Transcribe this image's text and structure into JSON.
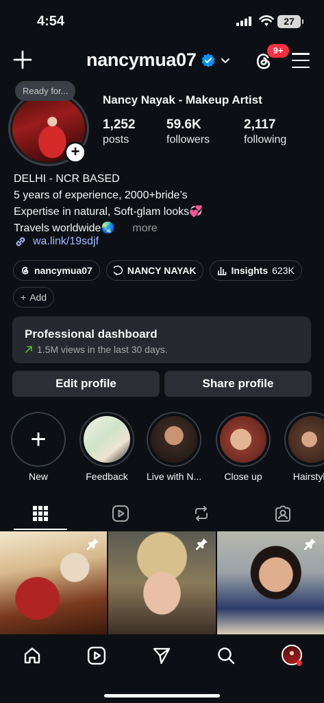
{
  "status_bar": {
    "time": "4:54",
    "battery": "27",
    "icons": [
      "signal-icon",
      "wifi-icon",
      "battery-icon"
    ]
  },
  "header": {
    "username": "nancymua07",
    "notification_badge": "9+",
    "icons": [
      "plus-icon",
      "verified-icon",
      "chevron-down-icon",
      "threads-icon",
      "menu-icon"
    ],
    "accent": "#0095f6",
    "badge_color": "#ff3040"
  },
  "profile": {
    "note": "Ready for...",
    "full_name": "Nancy Nayak - Makeup Artist",
    "stats": [
      {
        "value": "1,252",
        "label": "posts"
      },
      {
        "value": "59.6K",
        "label": "followers"
      },
      {
        "value": "2,117",
        "label": "following"
      }
    ],
    "bio_lines": [
      "DELHI - NCR BASED",
      "5 years of experience, 2000+bride’s",
      "Expertise in natural, Soft-glam looks💞",
      "Travels worldwide🌏"
    ],
    "bio_more": "more",
    "link": "wa.link/19sdjf"
  },
  "chips": {
    "threads": "nancymua07",
    "facebook": "NANCY NAYAK",
    "insights_label": "Insights",
    "insights_value": "623K",
    "add": "Add"
  },
  "dashboard": {
    "title": "Professional dashboard",
    "subtitle": "1.5M views in the last 30 days."
  },
  "actions": {
    "edit": "Edit profile",
    "share": "Share profile"
  },
  "highlights": [
    {
      "label": "New"
    },
    {
      "label": "Feedback"
    },
    {
      "label": "Live with N..."
    },
    {
      "label": "Close up"
    },
    {
      "label": "Hairstyle"
    }
  ],
  "tabs": [
    "grid-icon",
    "reels-icon",
    "reposts-icon",
    "tagged-icon"
  ],
  "bottom_nav": [
    "home-icon",
    "reels-icon",
    "send-icon",
    "search-icon",
    "profile-avatar"
  ]
}
